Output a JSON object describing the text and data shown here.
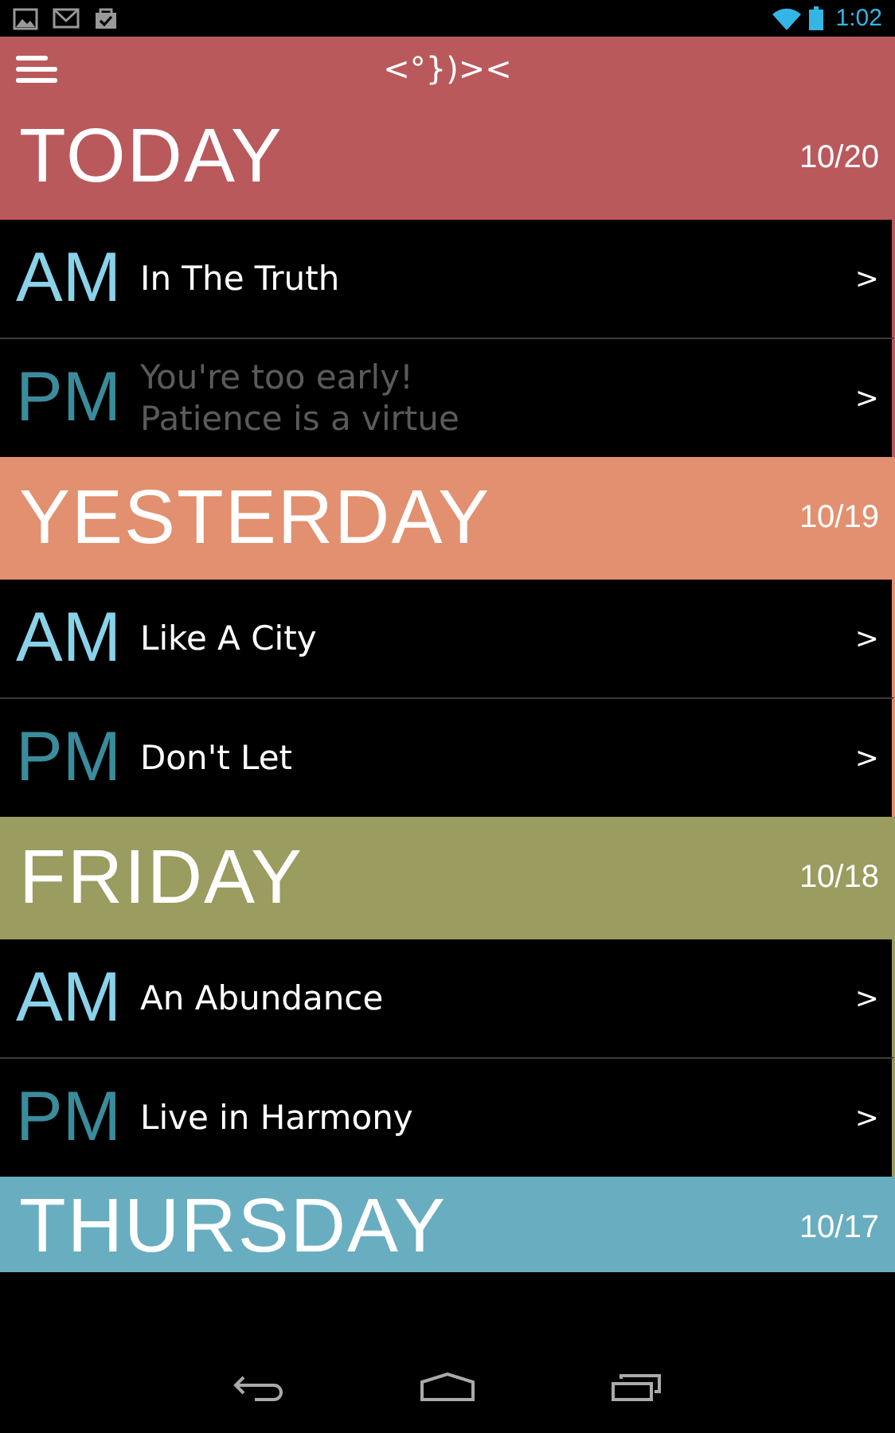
{
  "status_bar": {
    "time": "1:02"
  },
  "app_bar": {
    "logo": "<°})><"
  },
  "days": [
    {
      "name": "TODAY",
      "date": "10/20",
      "color": "#b9595c",
      "entries": [
        {
          "kind": "am",
          "label": "AM",
          "title": "In The Truth",
          "locked": false,
          "arrow": ">"
        },
        {
          "kind": "pm",
          "label": "PM",
          "title": "You're too early!\nPatience is a virtue",
          "locked": true,
          "arrow": ">"
        }
      ]
    },
    {
      "name": "YESTERDAY",
      "date": "10/19",
      "color": "#e2906f",
      "entries": [
        {
          "kind": "am",
          "label": "AM",
          "title": "Like A City",
          "locked": false,
          "arrow": ">"
        },
        {
          "kind": "pm",
          "label": "PM",
          "title": "Don't Let",
          "locked": false,
          "arrow": ">"
        }
      ]
    },
    {
      "name": "FRIDAY",
      "date": "10/18",
      "color": "#9a9c60",
      "entries": [
        {
          "kind": "am",
          "label": "AM",
          "title": "An Abundance",
          "locked": false,
          "arrow": ">"
        },
        {
          "kind": "pm",
          "label": "PM",
          "title": "Live in Harmony",
          "locked": false,
          "arrow": ">"
        }
      ]
    },
    {
      "name": "THURSDAY",
      "date": "10/17",
      "color": "#69adc0"
    }
  ]
}
